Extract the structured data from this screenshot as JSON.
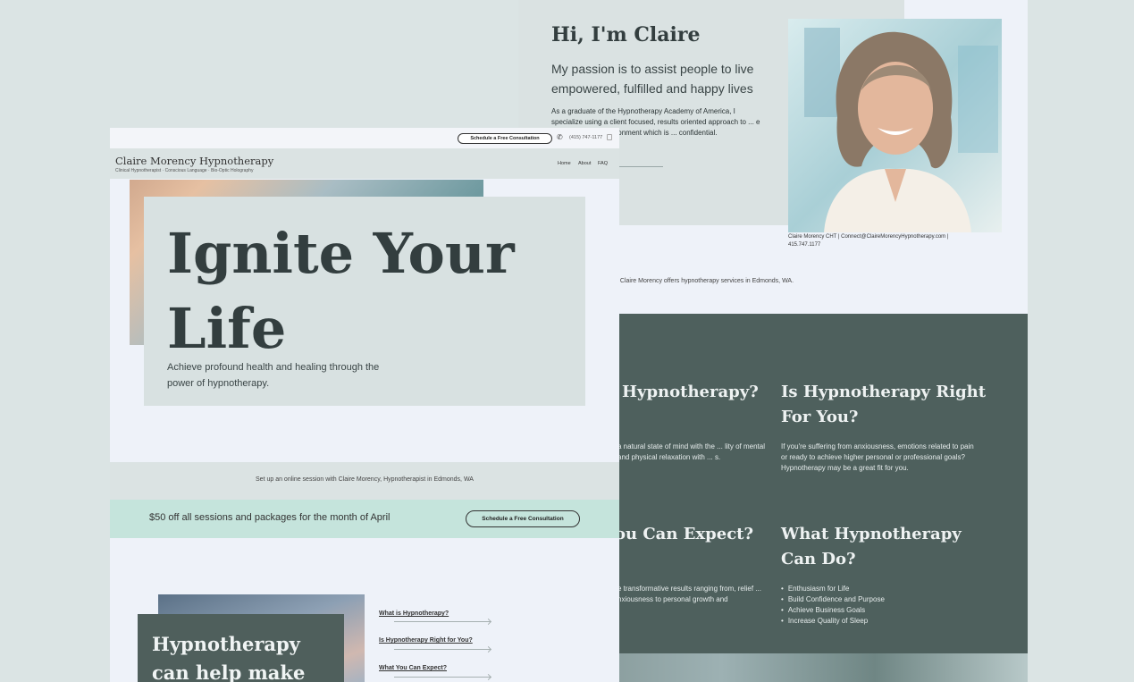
{
  "about": {
    "title": "Hi, I'm Claire",
    "lead": "My passion is to assist people to live empowered, fulfilled and happy lives",
    "body": "As a graduate of the Hypnotherapy Academy of America, I specialize using a client focused, results oriented approach to ... e and meaningful environment which is ... confidential.",
    "caption": "Claire Morency CHT | Connect@ClaireMorencyHypnotherapy.com | 415.747.1177",
    "services_line": "t Claire Morency offers hypnotherapy services in Edmonds, WA."
  },
  "info_sections": {
    "what_is": {
      "heading": "Hypnotherapy?",
      "text": "a natural state of mind with the ... lity of mental and physical relaxation with ... s."
    },
    "right_for_you": {
      "heading": "Is Hypnotherapy Right For You?",
      "text": "If you're suffering from anxiousness, emotions related to pain or ready to achieve higher personal or professional goals? Hypnotherapy may be a great fit for you."
    },
    "expect": {
      "heading": "ou Can Expect?",
      "text": "e transformative results ranging from, relief ... nxiousness to personal growth and"
    },
    "can_do": {
      "heading": "What Hypnotherapy Can Do?",
      "items": [
        "Enthusiasm for Life",
        "Build Confidence and Purpose",
        "Achieve Business Goals",
        "Increase Quality of Sleep"
      ]
    }
  },
  "topbar": {
    "schedule_label": "Schedule a Free Consultation",
    "phone": "(415) 747-1177"
  },
  "nav": {
    "brand": "Claire Morency Hypnotherapy",
    "tagline": "Clinical Hypnotherapist · Conscious Language · Bio-Optic Holography",
    "links": [
      "Home",
      "About",
      "FAQ"
    ]
  },
  "hero": {
    "title": "Ignite Your Life",
    "subtitle": "Achieve profound health and healing through the power of hypnotherapy."
  },
  "online_session": "Set up an online session with Claire Morency, Hypnotherapist in Edmonds, WA",
  "promo": {
    "text": "$50 off all sessions and packages for the month of April",
    "button": "Schedule a Free Consultation"
  },
  "bottom": {
    "title": "Hypnotherapy can help make lasting",
    "links": [
      "What is Hypnotherapy?",
      "Is Hypnotherapy Right for You?",
      "What You Can Expect?"
    ]
  },
  "colors": {
    "background": "#dbe4e4",
    "card": "#eef2f9",
    "panel": "#dae2e2",
    "teal": "#4e605d",
    "promo": "#c5e4dc"
  }
}
